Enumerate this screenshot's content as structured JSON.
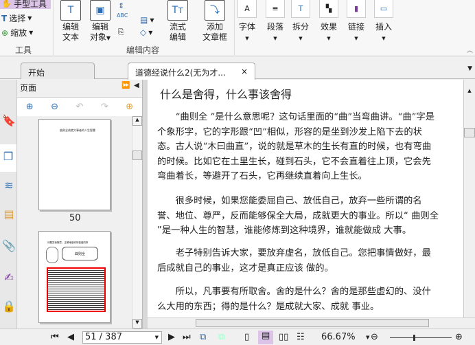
{
  "ribbon": {
    "tools": {
      "hand": "手型工具",
      "select": "选择",
      "zoom": "缩放",
      "group": "工具"
    },
    "edit": {
      "edit_text": [
        "编辑",
        "文本"
      ],
      "edit_object": [
        "编辑",
        "对象"
      ],
      "flow_edit": [
        "流式",
        "编辑"
      ],
      "add_textbox": [
        "添加",
        "文章框"
      ],
      "group": "编辑内容"
    },
    "buttons": [
      "字体",
      "段落",
      "拆分",
      "效果",
      "链接",
      "插入"
    ],
    "spell_icon_text": "ABC"
  },
  "tabs": [
    {
      "label": "开始"
    },
    {
      "label": "道德经说什么2(无为才...",
      "close": "×"
    }
  ],
  "panel": {
    "title": "页面",
    "thumb50_title": "曲则全成就大事者的人生智慧",
    "thumb50_label": "50",
    "thumb51_heading": "问题答我随意，正确地做你所能做的事",
    "thumb51_bubble": "曲则全"
  },
  "document": {
    "title": "什么是舍得，什么事该舍得",
    "paragraphs": [
      "“曲则全 ”是什么意思呢？这句话里面的“曲”当弯曲讲。“曲”字是个象形字，它的字形跟“凹”相似，形容的是坐到沙发上陷下去的状态。古人说“木曰曲直”，说的就是草木的生长有直的时候，也有弯曲的时候。比如它在土里生长，碰到石头，它不会直着往上顶，它会先弯曲着长，等避开了石头，它再继续直着向上生长。",
      "很多时候，如果您能委屈自己、放低自己，放弃一些所谓的名誉、地位、尊严，反而能够保全大局，成就更大的事业。所以“ 曲则全 ”是一种人生的智慧，谁能修炼到这种境界，谁就能做成 大事。",
      "老子特别告诉大家，要放弃虚名，放低自己。您把事情做好，最后成就自己的事业，这才是真正应该 做的。",
      "所以，凡事要有所取舍。舍的是什么？舍的是那些虚幻的、没什么大用的东西；得的是什么？是成就大家、成就 事业。"
    ]
  },
  "status": {
    "page": "51 / 387",
    "zoom": "66.67%",
    "zoom_level_percent": 66.67
  }
}
